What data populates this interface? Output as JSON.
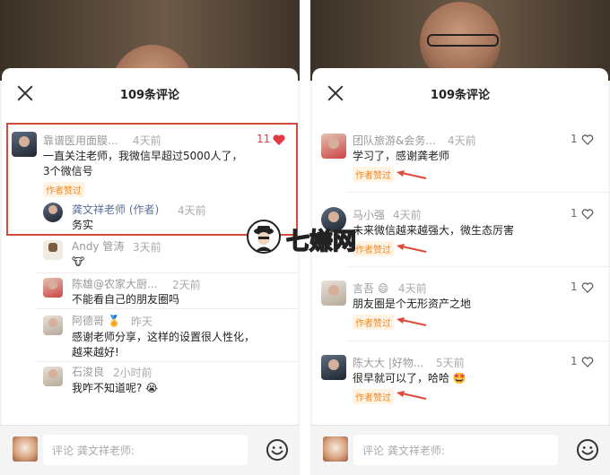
{
  "left": {
    "sheet_title": "109条评论",
    "comments": [
      {
        "name": "靠谱医用面膜...",
        "time": "4天前",
        "text": "一直关注老师，我微信早超过5000人了，3个微信号",
        "badge": "作者赞过",
        "likes": "11"
      },
      {
        "name": "龚文祥老师 (作者)",
        "time": "4天前",
        "text": "务实"
      },
      {
        "name": "Andy 管涛",
        "time": "3天前",
        "text": "🐮"
      },
      {
        "name": "陈雄@农家大厨...",
        "time": "2天前",
        "text": "不能看自己的朋友圈吗"
      },
      {
        "name": "阿德哥 🏅",
        "time": "昨天",
        "text": "感谢老师分享，这样的设置很人性化，越来越好!"
      },
      {
        "name": "石浚良",
        "time": "2小时前",
        "text": "我咋不知道呢? 😭"
      }
    ],
    "input_placeholder": "评论 龚文祥老师:"
  },
  "right": {
    "sheet_title": "109条评论",
    "comments": [
      {
        "name": "团队旅游&会务...",
        "time": "4天前",
        "text": "学习了，感谢龚老师",
        "badge": "作者赞过",
        "likes": "1"
      },
      {
        "name": "马小强",
        "time": "4天前",
        "text": "未来微信越来越强大，微生态厉害",
        "badge": "作者赞过",
        "likes": "1"
      },
      {
        "name": "言吾 😄",
        "time": "4天前",
        "text": "朋友圈是个无形资产之地",
        "badge": "作者赞过",
        "likes": "1"
      },
      {
        "name": "陈大大 |好物...",
        "time": "5天前",
        "text": "很早就可以了，哈哈 🤩",
        "badge": "作者赞过",
        "likes": "1"
      }
    ],
    "input_placeholder": "评论 龚文祥老师:"
  },
  "watermark": {
    "text": "七嫌网"
  },
  "colors": {
    "highlight_border": "#d24c3b",
    "badge_text": "#f08a24",
    "like_active": "#e63946",
    "arrow": "#e04a3a"
  }
}
